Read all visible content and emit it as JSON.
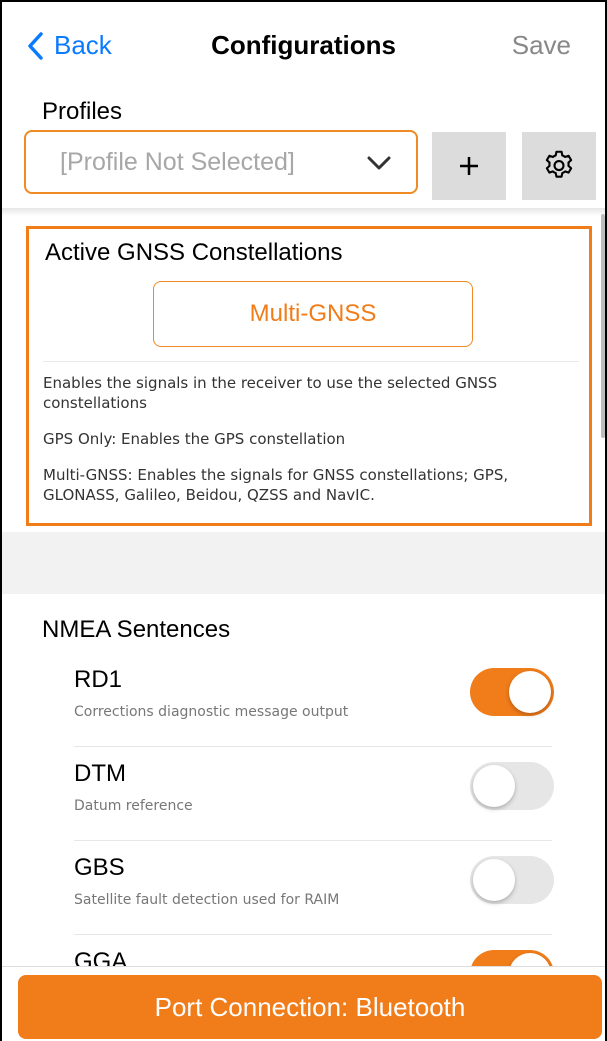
{
  "nav": {
    "back_label": "Back",
    "title": "Configurations",
    "save_label": "Save"
  },
  "profiles": {
    "label": "Profiles",
    "placeholder": "[Profile Not Selected]",
    "add_label": "+"
  },
  "gnss": {
    "title": "Active GNSS Constellations",
    "selected": "Multi-GNSS",
    "descriptions": [
      "Enables the signals in the receiver to use the selected GNSS constellations",
      "GPS Only: Enables the GPS constellation",
      "Multi-GNSS: Enables the signals for GNSS constellations; GPS, GLONASS, Galileo, Beidou, QZSS and NavIC."
    ]
  },
  "nmea": {
    "title": "NMEA Sentences",
    "items": [
      {
        "name": "RD1",
        "desc": "Corrections diagnostic message output",
        "enabled": true
      },
      {
        "name": "DTM",
        "desc": "Datum reference",
        "enabled": false
      },
      {
        "name": "GBS",
        "desc": "Satellite fault detection used for RAIM",
        "enabled": false
      },
      {
        "name": "GGA",
        "desc": "",
        "enabled": true
      }
    ]
  },
  "port": {
    "label": "Port Connection: Bluetooth"
  },
  "colors": {
    "accent": "#f07c1a",
    "ios_blue": "#0a7aff"
  }
}
